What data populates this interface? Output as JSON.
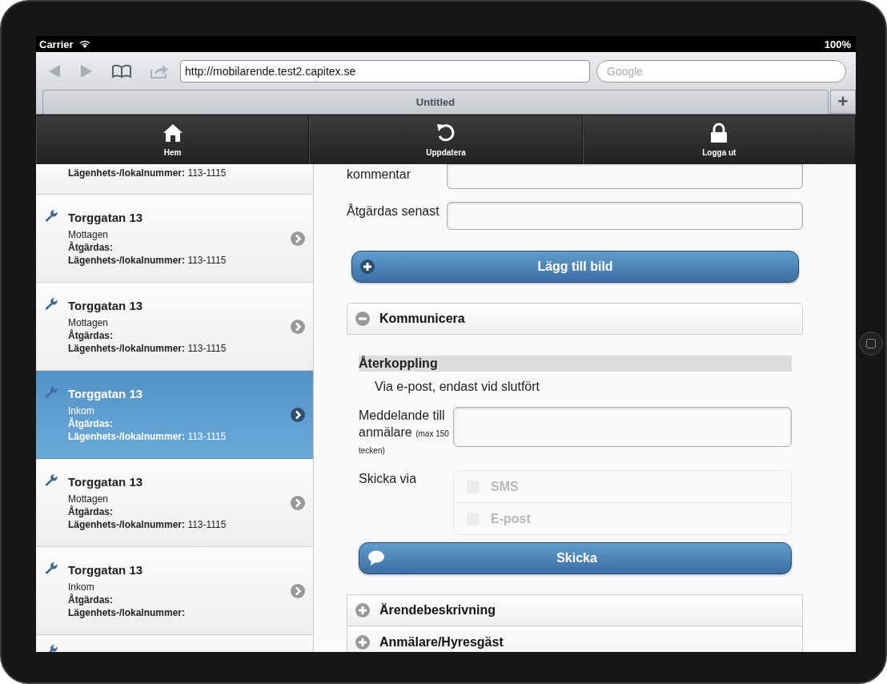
{
  "status_bar": {
    "carrier": "Carrier",
    "battery": "100%"
  },
  "browser": {
    "url": "http://mobilarende.test2.capitex.se",
    "search": {
      "placeholder": "Google"
    },
    "tab": {
      "title": "Untitled"
    },
    "new_tab": "+"
  },
  "navbar": [
    {
      "label": "Hem",
      "kind": "home"
    },
    {
      "label": "Uppdatera",
      "kind": "refresh"
    },
    {
      "label": "Logga ut",
      "kind": "logout"
    }
  ],
  "cases": [
    {
      "kind": "clipped_top",
      "unit_label": "Lägenhets-/lokalnummer:",
      "unit": "113-1115",
      "selected": false
    },
    {
      "kind": "full",
      "title": "Torggatan 13",
      "status": "Mottagen",
      "action_label": "Åtgärdas:",
      "unit_label": "Lägenhets-/lokalnummer:",
      "unit": "113-1115",
      "selected": false
    },
    {
      "kind": "full",
      "title": "Torggatan 13",
      "status": "Mottagen",
      "action_label": "Åtgärdas:",
      "unit_label": "Lägenhets-/lokalnummer:",
      "unit": "113-1115",
      "selected": false
    },
    {
      "kind": "full",
      "title": "Torggatan 13",
      "status": "Inkom",
      "action_label": "Åtgärdas:",
      "unit_label": "Lägenhets-/lokalnummer:",
      "unit": "113-1115",
      "selected": true
    },
    {
      "kind": "full",
      "title": "Torggatan 13",
      "status": "Mottagen",
      "action_label": "Åtgärdas:",
      "unit_label": "Lägenhets-/lokalnummer:",
      "unit": "113-1115",
      "selected": false
    },
    {
      "kind": "full",
      "title": "Torggatan 13",
      "status": "Inkom",
      "action_label": "Åtgärdas:",
      "unit_label": "Lägenhets-/lokalnummer:",
      "selected": false
    },
    {
      "kind": "clipped_bottom",
      "selected": false
    }
  ],
  "form": {
    "fields": [
      {
        "kind": "textarea_clipped",
        "label": "kommentar"
      },
      {
        "kind": "input",
        "label": "Åtgärdas senast"
      }
    ],
    "add_image_button": "Lägg till bild",
    "sections": [
      {
        "title": "Kommunicera",
        "expanded": true,
        "content": {
          "heading": "Återkoppling",
          "feedback": "Via e-post, endast vid slutfört",
          "message_label": "Meddelande till anmälare",
          "message_hint": "(max 150 tecken)",
          "send_via_label": "Skicka via",
          "channels": [
            {
              "label": "SMS",
              "checked": false,
              "disabled": true
            },
            {
              "label": "E-post",
              "checked": false,
              "disabled": true
            }
          ],
          "send_button": "Skicka"
        }
      },
      {
        "title": "Ärendebeskrivning",
        "expanded": false
      },
      {
        "title": "Anmälare/Hyresgäst",
        "expanded": false
      }
    ]
  }
}
